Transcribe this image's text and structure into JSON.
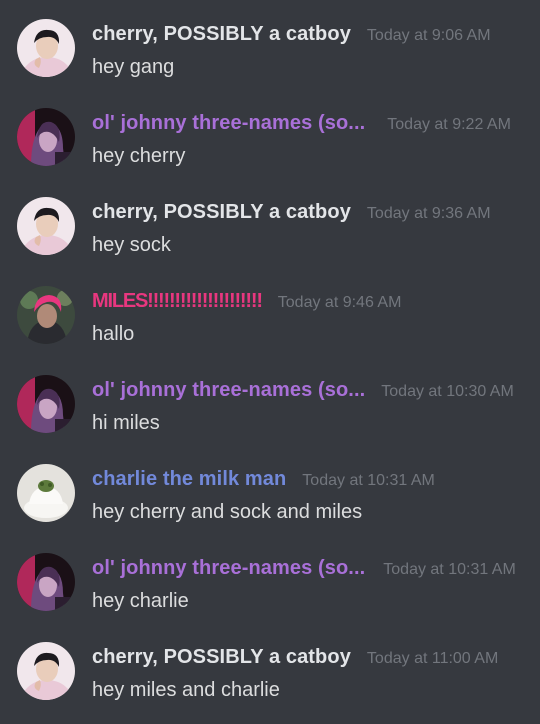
{
  "colors": {
    "background": "#36393f",
    "timestamp": "#72767d",
    "message_text": "#dcddde",
    "cherry": "#e3e5e8",
    "johnny": "#a970d8",
    "miles": "#e8377f",
    "charlie": "#7289da"
  },
  "messages": [
    {
      "author": "cherry, POSSIBLY a catboy",
      "author_color": "cherry",
      "avatar_icon": "cherry-avatar",
      "time": "Today at 9:06 AM",
      "text": "hey gang"
    },
    {
      "author": "ol' johnny three-names (so...",
      "author_color": "johnny",
      "avatar_icon": "johnny-avatar",
      "time": "Today at 9:22 AM",
      "text": "hey cherry"
    },
    {
      "author": "cherry, POSSIBLY a catboy",
      "author_color": "cherry",
      "avatar_icon": "cherry-avatar",
      "time": "Today at 9:36 AM",
      "text": "hey sock"
    },
    {
      "author": "MILES!!!!!!!!!!!!!!!!!!!!!",
      "author_color": "miles",
      "avatar_icon": "miles-avatar",
      "time": "Today at 9:46 AM",
      "text": "hallo"
    },
    {
      "author": "ol' johnny three-names (so...",
      "author_color": "johnny",
      "avatar_icon": "johnny-avatar",
      "time": "Today at 10:30 AM",
      "text": "hi miles"
    },
    {
      "author": "charlie the milk man",
      "author_color": "charlie",
      "avatar_icon": "charlie-avatar",
      "time": "Today at 10:31 AM",
      "text": "hey cherry and sock and miles"
    },
    {
      "author": "ol' johnny three-names (so...",
      "author_color": "johnny",
      "avatar_icon": "johnny-avatar",
      "time": "Today at 10:31 AM",
      "text": "hey charlie"
    },
    {
      "author": "cherry, POSSIBLY a catboy",
      "author_color": "cherry",
      "avatar_icon": "cherry-avatar",
      "time": "Today at 11:00 AM",
      "text": "hey miles and charlie"
    }
  ]
}
